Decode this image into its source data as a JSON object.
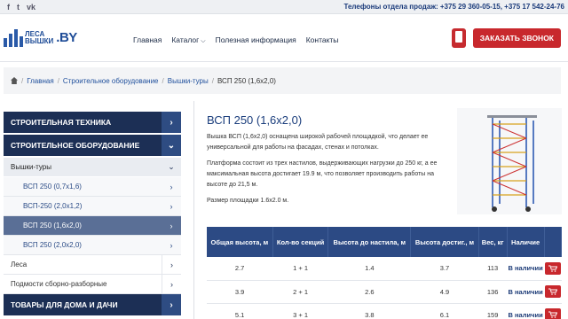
{
  "topbar": {
    "social": [
      "f",
      "t",
      "vk"
    ],
    "phones": "Телефоны отдела продаж: +375 29 360-05-15, +375 17 542-24-76"
  },
  "logo": {
    "line1": "ЛЕСА",
    "line2": "ВЫШКИ",
    "suffix": ".BY"
  },
  "nav": [
    {
      "label": "Главная"
    },
    {
      "label": "Каталог",
      "has_caret": true
    },
    {
      "label": "Полезная информация"
    },
    {
      "label": "Контакты"
    }
  ],
  "call_button": "ЗАКАЗАТЬ ЗВОНОК",
  "breadcrumbs": [
    {
      "label": "Главная"
    },
    {
      "label": "Строительное оборудование"
    },
    {
      "label": "Вышки-туры"
    },
    {
      "label": "ВСП 250 (1,6х2,0)"
    }
  ],
  "sidebar": {
    "categories": [
      {
        "label": "СТРОИТЕЛЬНАЯ ТЕХНИКА"
      },
      {
        "label": "СТРОИТЕЛЬНОЕ ОБОРУДОВАНИЕ"
      }
    ],
    "subcategory": "Вышки-туры",
    "items": [
      {
        "label": "ВСП 250 (0,7х1,6)"
      },
      {
        "label": "ВСП-250 (2,0х1,2)"
      },
      {
        "label": "ВСП 250 (1,6х2,0)",
        "active": true
      },
      {
        "label": "ВСП 250 (2,0х2,0)"
      }
    ],
    "other": [
      {
        "label": "Леса"
      },
      {
        "label": "Подмости сборно-разборные"
      }
    ],
    "last_category": "ТОВАРЫ ДЛЯ ДОМА И ДАЧИ"
  },
  "product": {
    "title": "ВСП 250 (1,6х2,0)",
    "desc1": "Вышка ВСП (1,6х2,0) оснащена широкой рабочей площадкой, что делает ее универсальной для работы на фасадах, стенах и потолках.",
    "desc2": "Платформа состоит из трех настилов, выдерживающих нагрузки до 250 кг, а ее максимальная высота достигает 19.9 м, что позволяет производить работы на высоте до 21,5 м.",
    "desc3": "Размер площадки 1.6х2.0 м."
  },
  "table": {
    "headers": [
      "Общая высота, м",
      "Кол-во секций",
      "Высота до настила, м",
      "Высота достиг., м",
      "Вес, кг",
      "Наличие",
      ""
    ],
    "rows": [
      [
        "2.7",
        "1 + 1",
        "1.4",
        "3.7",
        "113",
        "В наличии"
      ],
      [
        "3.9",
        "2 + 1",
        "2.6",
        "4.9",
        "136",
        "В наличии"
      ],
      [
        "5.1",
        "3 + 1",
        "3.8",
        "6.1",
        "159",
        "В наличии"
      ]
    ]
  },
  "colors": {
    "navy": "#1c2f55",
    "red": "#c8282d",
    "link": "#1f4f9c"
  }
}
